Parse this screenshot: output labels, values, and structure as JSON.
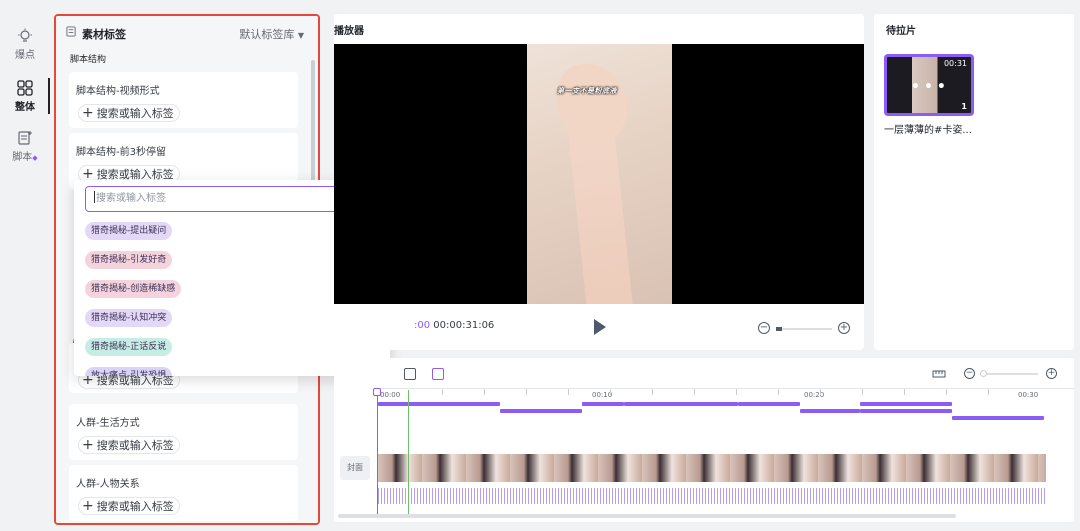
{
  "rail": {
    "items": [
      {
        "label": "爆点",
        "icon": "bulb-icon"
      },
      {
        "label": "整体",
        "icon": "grid-icon"
      },
      {
        "label": "脚本",
        "icon": "script-icon"
      }
    ]
  },
  "tag_panel": {
    "title": "素材标签",
    "library_selector": "默认标签库",
    "section_title": "脚本结构",
    "cards": [
      {
        "name": "脚本结构-视频形式",
        "add_label": "搜索或输入标签"
      },
      {
        "name": "脚本结构-前3秒停留",
        "add_label": "搜索或输入标签"
      },
      {
        "name": "",
        "add_label": "搜索或输入标签"
      },
      {
        "name": "人群-生活方式",
        "add_label": "搜索或输入标签"
      },
      {
        "name": "人群-人物关系",
        "add_label": "搜索或输入标签"
      }
    ],
    "peek_text": "人"
  },
  "dropdown": {
    "search_placeholder": "搜索或输入标签",
    "options": [
      {
        "label": "猎奇揭秘-提出疑问",
        "color": "#e3d9f7"
      },
      {
        "label": "猎奇揭秘-引发好奇",
        "color": "#f5d3dd"
      },
      {
        "label": "猎奇揭秘-创造稀缺感",
        "color": "#f5d3dd"
      },
      {
        "label": "猎奇揭秘-认知冲突",
        "color": "#e3d9f7"
      },
      {
        "label": "猎奇揭秘-正话反说",
        "color": "#c7ece4"
      },
      {
        "label": "放大痛点-引发恐惧",
        "color": "#d9d3f5"
      }
    ]
  },
  "player": {
    "title": "播放器",
    "caption": "第一支不是粉底液",
    "current_time": ":00",
    "total_time": "00:00:31:06"
  },
  "pending": {
    "title": "待拉片",
    "item": {
      "duration": "00:31",
      "count": "1",
      "name": "一层薄薄的#卡姿..."
    }
  },
  "timeline": {
    "tick_labels": [
      "00:00",
      "00:10",
      "00:20",
      "00:30"
    ],
    "cover_label": "封面"
  },
  "colors": {
    "accent": "#8b5cf6",
    "highlight_border": "#e5483a"
  }
}
